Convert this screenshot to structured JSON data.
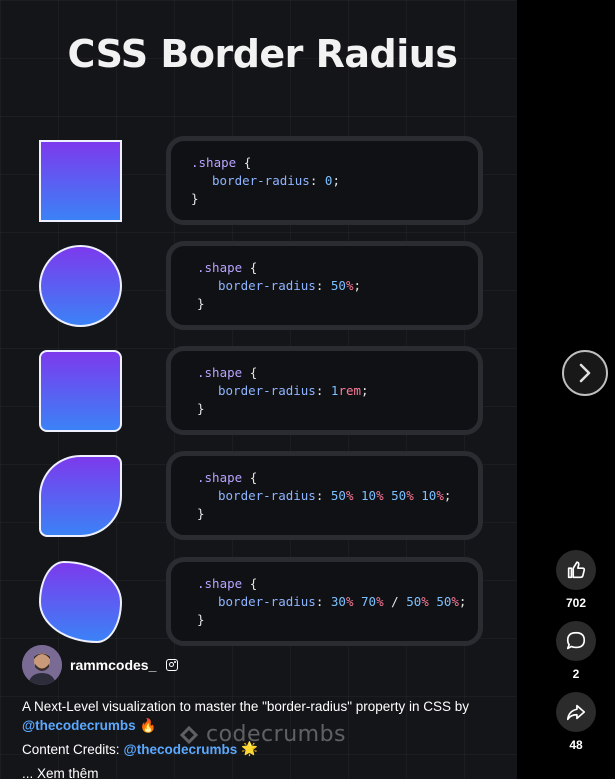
{
  "video": {
    "title": "CSS Border Radius",
    "watermark": "codecrumbs",
    "code_blocks": [
      {
        "selector": ".shape",
        "open": "{",
        "property": "border-radius",
        "value_parts": [
          {
            "t": "num",
            "v": "0"
          }
        ],
        "close": "}"
      },
      {
        "selector": ".shape",
        "open": "{",
        "property": "border-radius",
        "value_parts": [
          {
            "t": "num",
            "v": "50"
          },
          {
            "t": "unit",
            "v": "%"
          }
        ],
        "close": "}"
      },
      {
        "selector": ".shape",
        "open": "{",
        "property": "border-radius",
        "value_parts": [
          {
            "t": "num",
            "v": "1"
          },
          {
            "t": "unit",
            "v": "rem"
          }
        ],
        "close": "}"
      },
      {
        "selector": ".shape",
        "open": "{",
        "property": "border-radius",
        "value_parts": [
          {
            "t": "num",
            "v": "50"
          },
          {
            "t": "unit",
            "v": "%"
          },
          {
            "t": "sp",
            "v": " "
          },
          {
            "t": "num",
            "v": "10"
          },
          {
            "t": "unit",
            "v": "%"
          },
          {
            "t": "sp",
            "v": " "
          },
          {
            "t": "num",
            "v": "50"
          },
          {
            "t": "unit",
            "v": "%"
          },
          {
            "t": "sp",
            "v": " "
          },
          {
            "t": "num",
            "v": "10"
          },
          {
            "t": "unit",
            "v": "%"
          }
        ],
        "close": "}"
      },
      {
        "selector": ".shape",
        "open": "{",
        "property": "border-radius",
        "value_parts": [
          {
            "t": "num",
            "v": "30"
          },
          {
            "t": "unit",
            "v": "%"
          },
          {
            "t": "sp",
            "v": " "
          },
          {
            "t": "num",
            "v": "70"
          },
          {
            "t": "unit",
            "v": "%"
          },
          {
            "t": "sp",
            "v": " / "
          },
          {
            "t": "num",
            "v": "50"
          },
          {
            "t": "unit",
            "v": "%"
          },
          {
            "t": "sp",
            "v": " "
          },
          {
            "t": "num",
            "v": "50"
          },
          {
            "t": "unit",
            "v": "%"
          }
        ],
        "close": "}"
      }
    ]
  },
  "author": {
    "username": "rammcodes_",
    "platform_icon": "instagram-icon"
  },
  "caption": {
    "text": "A Next-Level visualization to master the \"border-radius\" property in CSS by",
    "mention": "@thecodecrumbs",
    "emoji": "🔥"
  },
  "credits": {
    "label": "Content Credits:",
    "mention": "@thecodecrumbs",
    "emoji": "🌟"
  },
  "see_more": "... Xem thêm",
  "actions": {
    "like_count": "702",
    "comment_count": "2",
    "share_count": "48"
  },
  "colors": {
    "shape_gradient_top": "#7c3aed",
    "shape_gradient_bottom": "#3b82f6",
    "mention": "#5aa9ff"
  }
}
